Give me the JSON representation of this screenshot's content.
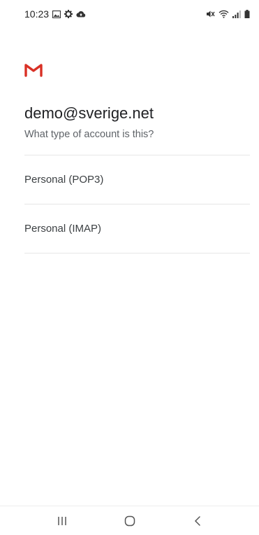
{
  "status_bar": {
    "time": "10:23"
  },
  "account": {
    "email": "demo@sverige.net",
    "question": "What type of account is this?"
  },
  "options": [
    {
      "label": "Personal (POP3)"
    },
    {
      "label": "Personal (IMAP)"
    }
  ],
  "colors": {
    "gmail_red": "#d93025",
    "text_primary": "#202124",
    "text_secondary": "#5f6368",
    "divider": "#e6e6e6"
  },
  "icons": {
    "status_left": [
      "gallery-icon",
      "gear-icon",
      "cloud-upload-icon"
    ],
    "status_right": [
      "mute-icon",
      "wifi-icon",
      "signal-icon",
      "battery-icon"
    ],
    "nav": [
      "recent-apps-icon",
      "home-icon",
      "back-icon"
    ]
  }
}
